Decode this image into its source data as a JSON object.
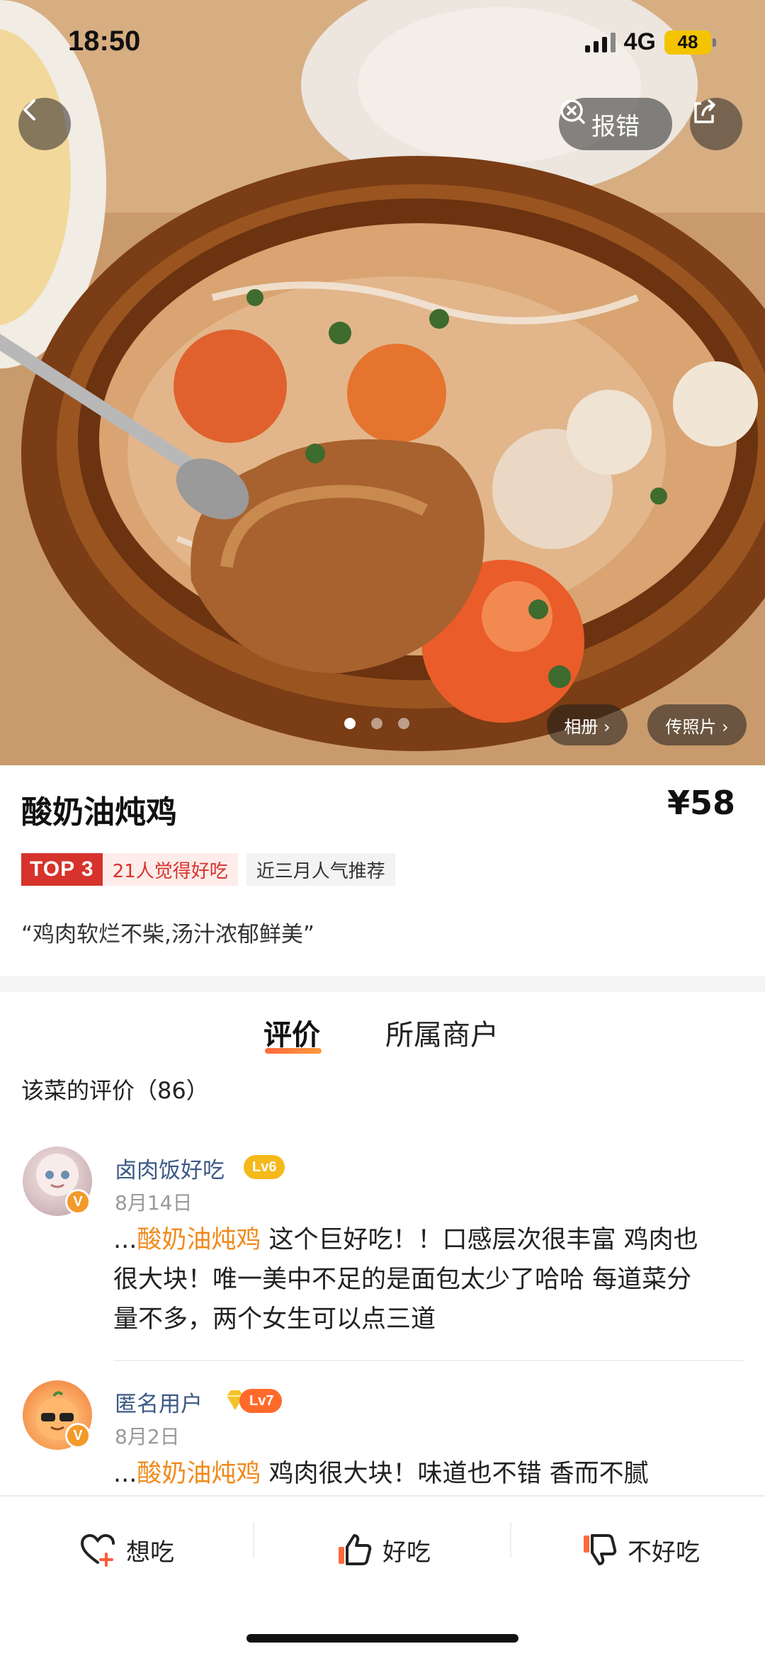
{
  "status_bar": {
    "time": "18:50",
    "network": "4G",
    "battery": "48"
  },
  "hero": {
    "report_label": "报错",
    "carousel": {
      "count": 3,
      "active_index": 0
    },
    "album_label": "相册 ›",
    "upload_label": "传照片 ›"
  },
  "dish": {
    "name": "酸奶油炖鸡",
    "price": "¥58",
    "rank_badge": "TOP 3",
    "rank_text": "21人觉得好吃",
    "popularity_tag": "近三月人气推荐",
    "quote": "“鸡肉软烂不柴,汤汁浓郁鲜美”"
  },
  "tabs": [
    {
      "label": "评价",
      "active": true
    },
    {
      "label": "所属商户",
      "active": false
    }
  ],
  "reviews_header": "该菜的评价（86）",
  "reviews": [
    {
      "username": "卤肉饭好吃",
      "level": "Lv6",
      "badge": "V",
      "date": "8月14日",
      "prefix": "...",
      "highlight": "酸奶油炖鸡",
      "text": " 这个巨好吃！！口感层次很丰富 鸡肉也很大块！唯一美中不足的是面包太少了哈哈 每道菜分量不多，两个女生可以点三道"
    },
    {
      "username": "匿名用户",
      "level": "Lv7",
      "badge": "V",
      "date": "8月2日",
      "prefix": "...",
      "highlight": "酸奶油炖鸡",
      "text": " 鸡肉很大块！味道也不错 香而不腻"
    }
  ],
  "bottom_bar": {
    "want_label": "想吃",
    "good_label": "好吃",
    "bad_label": "不好吃"
  },
  "colors": {
    "accent_orange": "#f08a1c",
    "top3_red": "#d6332c",
    "username_blue": "#3d5a84",
    "level6": "#f5b91c",
    "level7": "#ff6a2b"
  }
}
